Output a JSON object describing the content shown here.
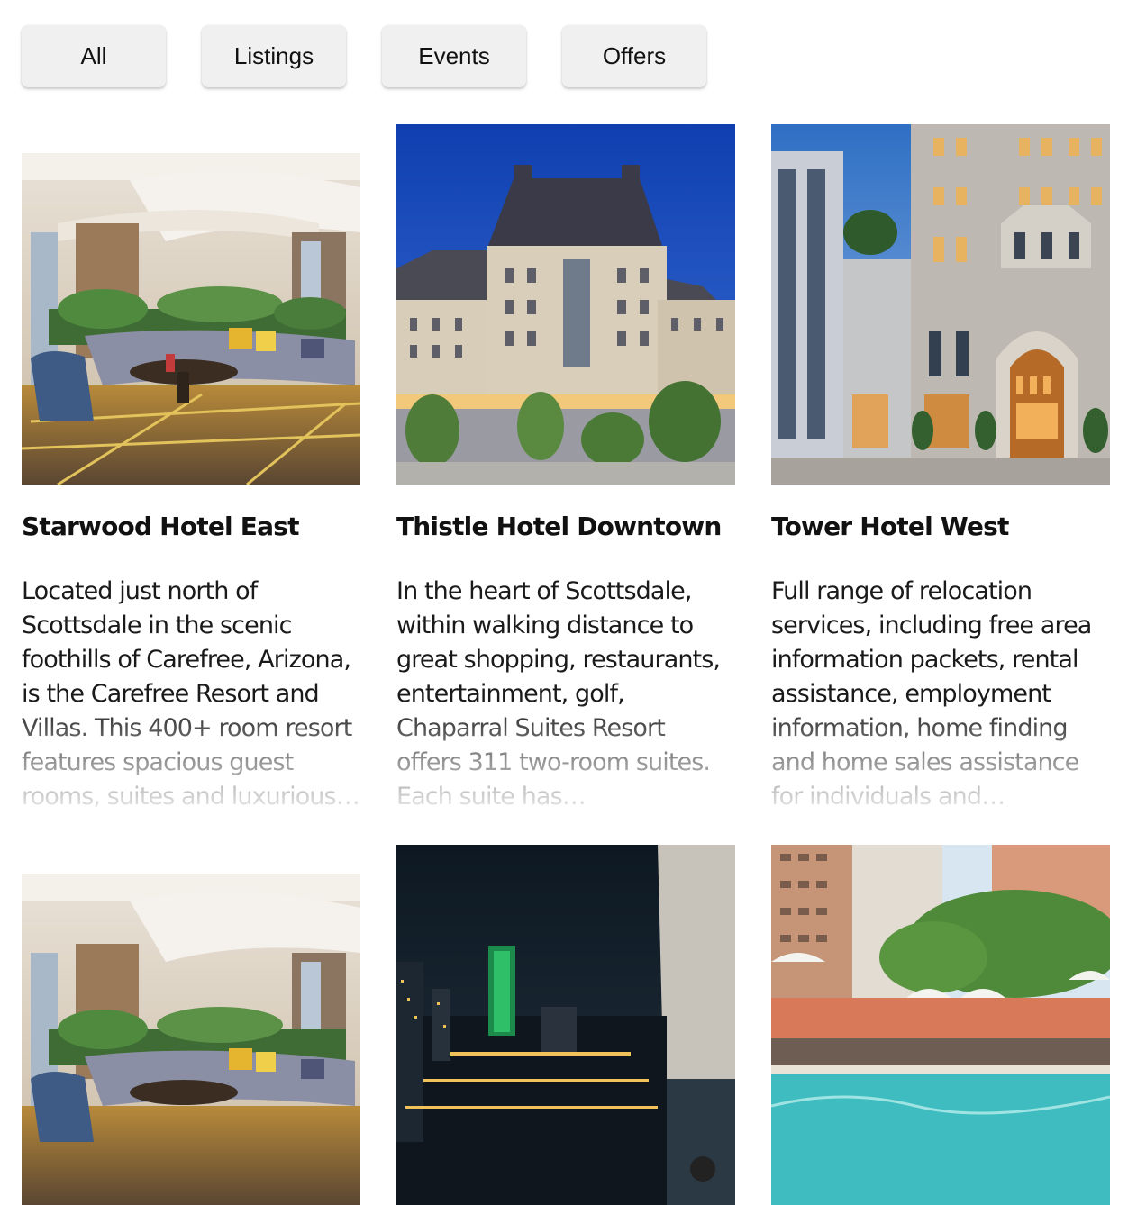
{
  "filters": [
    {
      "label": "All"
    },
    {
      "label": "Listings"
    },
    {
      "label": "Events"
    },
    {
      "label": "Offers"
    }
  ],
  "cards": [
    {
      "title": "Starwood Hotel East",
      "description": "Located just north of Scottsdale in the scenic foothills of Carefree, Arizona, is the Carefree Resort and Villas. This 400+ room resort features spacious guest rooms, suites and luxurious…",
      "image": "hotel-lobby-photo"
    },
    {
      "title": "Thistle Hotel Downtown",
      "description": "In the heart of Scottsdale, within walking distance to great shopping, restaurants, entertainment, golf, Chaparral Suites Resort offers 311 two-room suites. Each suite has…",
      "image": "chateau-hotel-exterior-photo"
    },
    {
      "title": "Tower Hotel West",
      "description": "Full range of relocation services, including free area information packets, rental assistance, employment information, home finding and home sales assistance for individuals and…",
      "image": "tower-hotel-facade-photo"
    },
    {
      "image": "hotel-lobby-photo"
    },
    {
      "image": "city-night-skyline-photo"
    },
    {
      "image": "rooftop-pool-photo"
    }
  ]
}
